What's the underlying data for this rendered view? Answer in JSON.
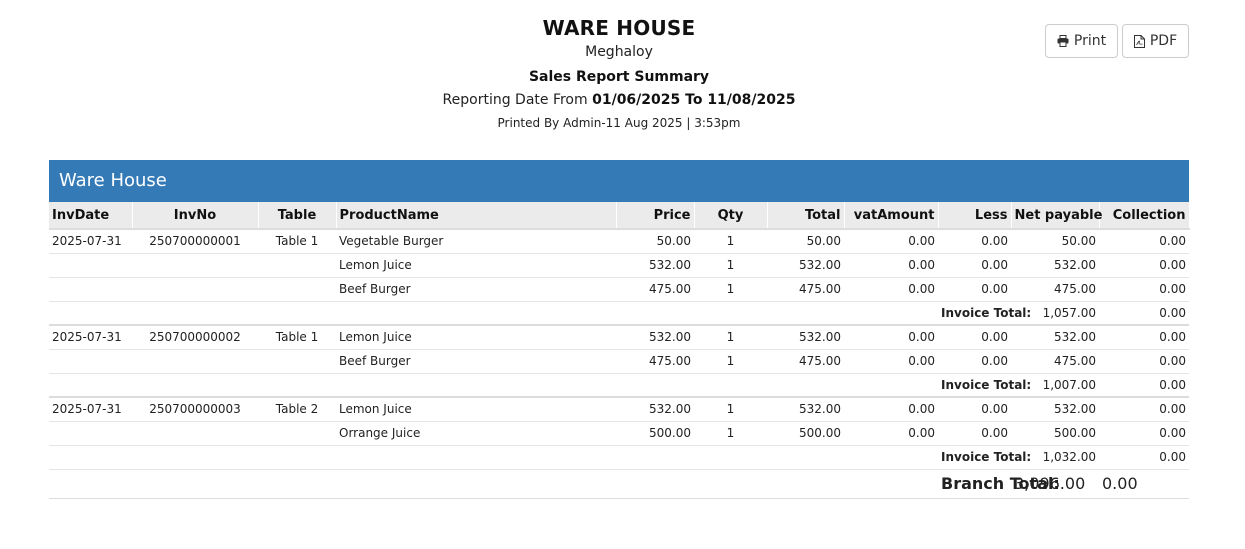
{
  "header": {
    "company": "WARE HOUSE",
    "location": "Meghaloy",
    "report_title": "Sales Report Summary",
    "date_prefix": "Reporting Date From ",
    "date_from": "01/06/2025",
    "date_sep": " To ",
    "date_to": "11/08/2025",
    "printed_by": "Printed By Admin-11 Aug 2025 | 3:53pm"
  },
  "toolbar": {
    "print_label": "Print",
    "pdf_label": "PDF"
  },
  "panel": {
    "title": "Ware House"
  },
  "columns": [
    "InvDate",
    "InvNo",
    "Table",
    "ProductName",
    "Price",
    "Qty",
    "Total",
    "vatAmount",
    "Less",
    "Net payable",
    "Collection"
  ],
  "invoices": [
    {
      "date": "2025-07-31",
      "no": "250700000001",
      "table": "Table 1",
      "items": [
        {
          "product": "Vegetable Burger",
          "price": "50.00",
          "qty": "1",
          "total": "50.00",
          "vat": "0.00",
          "less": "0.00",
          "net": "50.00",
          "collection": "0.00"
        },
        {
          "product": "Lemon Juice",
          "price": "532.00",
          "qty": "1",
          "total": "532.00",
          "vat": "0.00",
          "less": "0.00",
          "net": "532.00",
          "collection": "0.00"
        },
        {
          "product": "Beef Burger",
          "price": "475.00",
          "qty": "1",
          "total": "475.00",
          "vat": "0.00",
          "less": "0.00",
          "net": "475.00",
          "collection": "0.00"
        }
      ],
      "total_label": "Invoice Total:",
      "total_net": "1,057.00",
      "total_collection": "0.00"
    },
    {
      "date": "2025-07-31",
      "no": "250700000002",
      "table": "Table 1",
      "items": [
        {
          "product": "Lemon Juice",
          "price": "532.00",
          "qty": "1",
          "total": "532.00",
          "vat": "0.00",
          "less": "0.00",
          "net": "532.00",
          "collection": "0.00"
        },
        {
          "product": "Beef Burger",
          "price": "475.00",
          "qty": "1",
          "total": "475.00",
          "vat": "0.00",
          "less": "0.00",
          "net": "475.00",
          "collection": "0.00"
        }
      ],
      "total_label": "Invoice Total:",
      "total_net": "1,007.00",
      "total_collection": "0.00"
    },
    {
      "date": "2025-07-31",
      "no": "250700000003",
      "table": "Table 2",
      "items": [
        {
          "product": "Lemon Juice",
          "price": "532.00",
          "qty": "1",
          "total": "532.00",
          "vat": "0.00",
          "less": "0.00",
          "net": "532.00",
          "collection": "0.00"
        },
        {
          "product": "Orrange Juice",
          "price": "500.00",
          "qty": "1",
          "total": "500.00",
          "vat": "0.00",
          "less": "0.00",
          "net": "500.00",
          "collection": "0.00"
        }
      ],
      "total_label": "Invoice Total:",
      "total_net": "1,032.00",
      "total_collection": "0.00"
    }
  ],
  "branch_total": {
    "label": "Branch Total:",
    "net": "3,096.00",
    "collection": "0.00"
  },
  "icons": {
    "print": "printer-icon",
    "pdf": "pdf-file-icon"
  },
  "colors": {
    "panel_header": "#337ab7"
  }
}
